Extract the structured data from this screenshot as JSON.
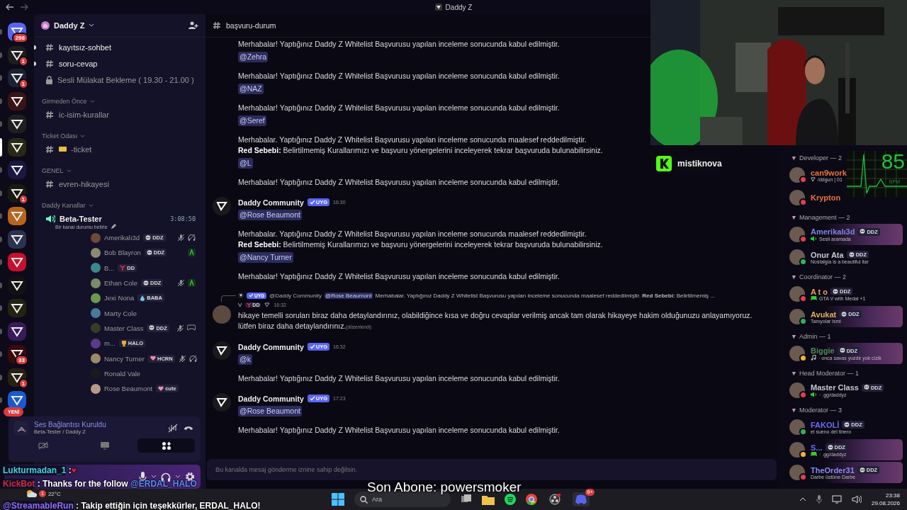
{
  "window": {
    "title": "Daddy Z"
  },
  "servers": [
    {
      "color": "#5865f2",
      "badge": "298",
      "selected": false
    },
    {
      "color": "#1d1d1d",
      "badge": "1",
      "selected": false
    },
    {
      "color": "#1a2233",
      "badge": "1",
      "selected": false
    },
    {
      "color": "#3a1414",
      "selected": false
    },
    {
      "color": "#1f1f1f",
      "selected": false
    },
    {
      "color": "#2a2a14",
      "selected": true
    },
    {
      "color": "#1b1840",
      "selected": false
    },
    {
      "color": "#1a1a10",
      "badge": "1",
      "selected": false
    },
    {
      "color": "#b8641c",
      "selected": false
    },
    {
      "color": "#2c3350",
      "selected": false
    },
    {
      "color": "#c8102e",
      "selected": false
    },
    {
      "color": "#121212",
      "selected": false
    },
    {
      "color": "#23230f",
      "selected": false
    },
    {
      "color": "#3a1a5a",
      "selected": false
    },
    {
      "color": "#3a0a0a",
      "badge": "33",
      "selected": false
    },
    {
      "color": "#2a2010",
      "badge": "1",
      "selected": false
    },
    {
      "color": "#1a5ad0",
      "selected": false
    }
  ],
  "new_pill": "YENİ",
  "server_name": "Daddy Z",
  "top_channels": [
    {
      "kind": "text",
      "name": "kayıtsız-sohbet",
      "unread": true
    },
    {
      "kind": "text",
      "name": "soru-cevap",
      "unread": true
    },
    {
      "kind": "locked",
      "name": "Sesli Mülakat Bekleme ( 19.30 - 21.00 )",
      "unread": false
    }
  ],
  "categories": [
    {
      "name": "Girmeden Önce",
      "channels": [
        {
          "kind": "text",
          "name": "ic-isim-kurallar"
        }
      ]
    },
    {
      "name": "Ticket Odası",
      "channels": [
        {
          "kind": "ticket",
          "name": "-ticket"
        }
      ]
    },
    {
      "name": "GENEL",
      "channels": [
        {
          "kind": "text",
          "name": "evren-hikayesi"
        }
      ]
    },
    {
      "name": "Daddy Kanallar",
      "channels": [
        {
          "kind": "voice",
          "name": "Beta-Tester",
          "timer": "3:08:50",
          "status": "Bir kanal durumu belirle",
          "members": [
            {
              "name": "Amerikalı3d",
              "tag": {
                "label": "DDZ",
                "kind": "skull"
              },
              "indicators": [
                {
                  "kind": "mic-off"
                },
                {
                  "kind": "headset-off"
                }
              ]
            },
            {
              "name": "Bob Blayron",
              "tag": {
                "label": "DDZ",
                "kind": "skull"
              },
              "indicators": [
                {
                  "kind": "activity"
                }
              ]
            },
            {
              "name": "B...",
              "tag": {
                "label": "DD",
                "kind": "y"
              }
            },
            {
              "name": "Ethan Cole",
              "tag": {
                "label": "DDZ",
                "kind": "skull"
              },
              "indicators": [
                {
                  "kind": "mic-off"
                },
                {
                  "kind": "activity"
                }
              ]
            },
            {
              "name": "Jexi Nona",
              "tag": {
                "label": "BABA",
                "kind": "drop"
              }
            },
            {
              "name": "Marty Cole"
            },
            {
              "name": "Master Class",
              "tag": {
                "label": "DDZ",
                "kind": "skull"
              },
              "indicators": [
                {
                  "kind": "mic-off"
                },
                {
                  "kind": "controller"
                }
              ]
            },
            {
              "name": "m...",
              "tag": {
                "label": "HALO",
                "kind": "trophy"
              }
            },
            {
              "name": "Nancy Turner",
              "tag": {
                "label": "HCRN",
                "kind": "heart"
              },
              "indicators": [
                {
                  "kind": "mic-off"
                },
                {
                  "kind": "headset-off"
                }
              ]
            },
            {
              "name": "Ronald Vale"
            },
            {
              "name": "Rose Beaumont",
              "tag": {
                "label": "cute",
                "kind": "heart"
              }
            }
          ]
        }
      ]
    }
  ],
  "voice_panel": {
    "title": "Ses Bağlantısı Kuruldu",
    "subtitle": "Beta-Tester / Daddy Z"
  },
  "channel": {
    "name": "başvuru-durum"
  },
  "messages": [
    {
      "kind": "plain",
      "lines": [
        "Merhabalar! Yaptığınız Daddy Z Whitelist Başvurusu yapılan inceleme sonucunda kabul edilmiştir."
      ],
      "mention": "@Zehra"
    },
    {
      "kind": "plain",
      "lines": [
        "Merhabalar! Yaptığınız Daddy Z Whitelist Başvurusu yapılan inceleme sonucunda kabul edilmiştir."
      ],
      "mention": "@NAZ"
    },
    {
      "kind": "plain",
      "lines": [
        "Merhabalar! Yaptığınız Daddy Z Whitelist Başvurusu yapılan inceleme sonucunda kabul edilmiştir."
      ],
      "mention": "@Seref"
    },
    {
      "kind": "plain",
      "lines": [
        "Merhabalar. Yaptığınız Daddy Z Whitelist Başvurusu yapılan inceleme sonucunda maalesef reddedilmiştir.",
        "**Red Sebebi:** Belirtilmemiş Kurallarımızı ve başvuru yönergelerini inceleyerek tekrar başvuruda bulunabilirsiniz."
      ],
      "mention": "@L"
    },
    {
      "kind": "plain",
      "lines": [
        "Merhabalar! Yaptığınız Daddy Z Whitelist Başvurusu yapılan inceleme sonucunda kabul edilmiştir."
      ]
    },
    {
      "kind": "header",
      "author": "Daddy Community",
      "badge": "UYG",
      "time": "16:30",
      "mention": "@Rose Beaumont"
    },
    {
      "kind": "plain",
      "lines": [
        "Merhabalar. Yaptığınız Daddy Z Whitelist Başvurusu yapılan inceleme sonucunda maalesef reddedilmiştir.",
        "**Red Sebebi:** Belirtilmemiş Kurallarımızı ve başvuru yönergelerini inceleyerek tekrar başvuruda bulunabilirsiniz."
      ],
      "mention": "@Nancy Turner"
    },
    {
      "kind": "plain",
      "lines": [
        "Merhabalar! Yaptığınız Daddy Z Whitelist Başvurusu yapılan inceleme sonucunda kabul edilmiştir."
      ]
    },
    {
      "kind": "reply",
      "reply_badge": "UYG",
      "reply_author": "@Daddy Community",
      "reply_mention": "@Rose Beaumont",
      "reply_text": "Merhabalar. Yaptığınız Daddy Z Whitelist Başvurusu yapılan inceleme sonucunda maalesef reddedilmiştir. **Red Sebebi:** Belirtilmemiş ...",
      "author": "V",
      "badge": "DD",
      "time": "16:32",
      "lines": [
        "hikaye temelli soruları biraz daha detaylandırınız, olabildiğince kısa ve doğru cevaplar verilmiş ancak tam olarak hikayeye hakim olduğunuzu anlayamıyoruz. lütfen biraz daha detaylandırınız."
      ],
      "edited": "(düzenlendi)"
    },
    {
      "kind": "header",
      "author": "Daddy Community",
      "badge": "UYG",
      "time": "16:32",
      "mention": "@k"
    },
    {
      "kind": "plain",
      "lines": [
        "Merhabalar! Yaptığınız Daddy Z Whitelist Başvurusu yapılan inceleme sonucunda kabul edilmiştir."
      ]
    },
    {
      "kind": "header",
      "author": "Daddy Community",
      "badge": "UYG",
      "time": "17:23",
      "mention": "@Rose Beaumont"
    },
    {
      "kind": "plain",
      "lines": [
        "Merhabalar! Yaptığınız Daddy Z Whitelist Başvurusu yapılan inceleme sonucunda kabul edilmiştir."
      ]
    }
  ],
  "input": {
    "placeholder": "Bu kanalda mesaj gönderme iznine sahip değilsin."
  },
  "member_groups": [
    {
      "title": "Developer — 2",
      "members": [
        {
          "name": "can9work",
          "color": "#e8743c",
          "status": {
            "color": "#e0404a"
          },
          "activity": {
            "text": "/ddgun | 01",
            "kind": "logo"
          },
          "banner": false
        },
        {
          "name": "Krypton",
          "color": "#e8743c",
          "status": {
            "color": "#e0404a"
          },
          "banner": false
        }
      ]
    },
    {
      "title": "Management — 2",
      "members": [
        {
          "name": "Amerikalı3d",
          "color": "#7f86e8",
          "tag": "DDZ",
          "status": {
            "color": "#e0404a"
          },
          "activity": {
            "text": "Sesli aramada",
            "kind": "speaker"
          },
          "banner": true
        },
        {
          "name": "Onur Ata",
          "color": "#c9c9d6",
          "tag": "DDZ",
          "status": {
            "color": "#2fb25a"
          },
          "activity": {
            "text": "Nostalgia is a beautiful liar"
          },
          "banner": false
        }
      ]
    },
    {
      "title": "Coordinator — 2",
      "members": [
        {
          "name": "A t o",
          "color": "#e8a05a",
          "tag": "DDZ",
          "status": {
            "color": "#e0404a"
          },
          "activity": {
            "text": "GTA V with Medal +1",
            "kind": "controller"
          },
          "banner": false
        },
        {
          "name": "Avukat",
          "color": "#e0b060",
          "tag": "DDZ",
          "status": {
            "color": "#2fb25a"
          },
          "activity": {
            "text": "Tanıyolar ismi"
          },
          "banner": true
        }
      ]
    },
    {
      "title": "Admin — 1",
      "members": [
        {
          "name": "Biggie",
          "color": "#4f8a5a",
          "tag": "DDZ",
          "status": {
            "color": "#f0b232"
          },
          "activity": {
            "text": "· onca savas yuzde yok cizik",
            "kind": "music"
          },
          "banner": true
        }
      ]
    },
    {
      "title": "Head Moderator — 1",
      "members": [
        {
          "name": "Master Class",
          "color": "#c9c9d6",
          "tag": "DDZ",
          "status": {
            "color": "#e0404a"
          },
          "activity": {
            "text": "· .gg/daddyz",
            "kind": "speaker"
          },
          "banner": false
        }
      ]
    },
    {
      "title": "Moderator — 3",
      "members": [
        {
          "name": "FAKOLİ",
          "color": "#6a6cf0",
          "tag": "DDZ",
          "status": {
            "color": "#2fb25a"
          },
          "activity": {
            "text": "el sueno del tinero"
          },
          "banner": false
        },
        {
          "name": "S...",
          "color": "#6a6cf0",
          "tag": "DDZ",
          "status": {
            "color": "#f0b232"
          },
          "activity": {
            "text": "· .gg/daddyz",
            "kind": "controller"
          },
          "banner": true
        },
        {
          "name": "TheOrder31",
          "color": "#8a8cf0",
          "tag": "DDZ",
          "status": {
            "color": "#e0404a"
          },
          "activity": {
            "text": "Darbe üstüne Darbe"
          },
          "banner": true
        }
      ]
    }
  ],
  "stream": {
    "streamer": "mistiknova",
    "heart_rate": "85",
    "heart_unit": "BPM",
    "last_sub": "Son Abone: powersmoker",
    "chat": [
      {
        "user": "Lukturmadan_1",
        "color": "#3fd0e0",
        "text": " :",
        "heart": "♥"
      },
      {
        "user": "KickBot",
        "color": "#d0283a",
        "text": " : Thanks for the follow ",
        "mention": "@ERDAL_HALO"
      },
      {
        "user": "@StreamableRun",
        "color": "#8a6cf0",
        "text": " : Takip ettiğin için teşekkürler, ERDAL_HALO!"
      }
    ]
  },
  "taskbar": {
    "search_placeholder": "Ara",
    "weather": "22°C",
    "weather_badge": "1",
    "discord_badge": "9+",
    "time": "23:38",
    "date": "29.08.2026"
  }
}
